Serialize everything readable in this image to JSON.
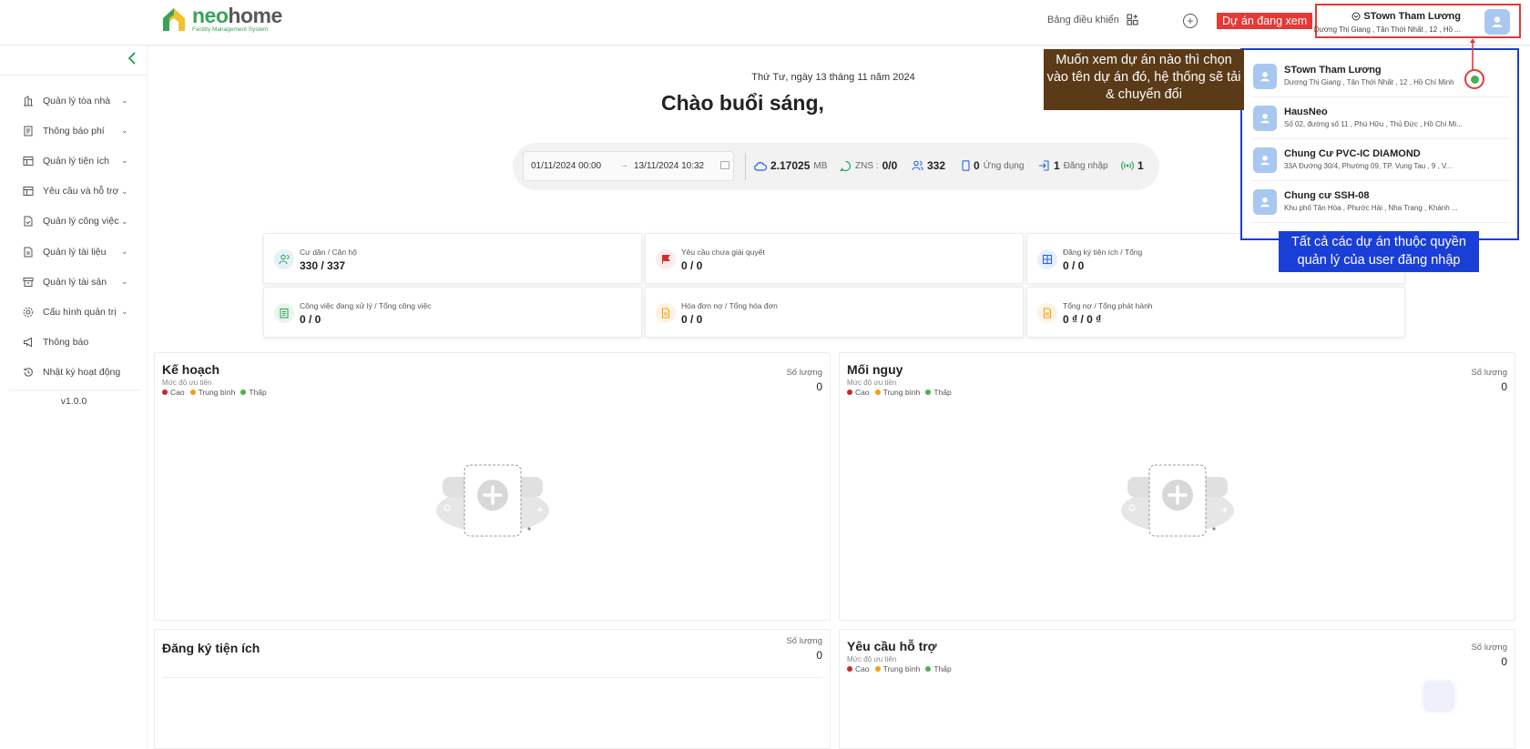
{
  "header": {
    "logo_word_a": "neo",
    "logo_word_b": "home",
    "logo_subtitle": "Facility Management System",
    "dashboard_label": "Bảng điều khiển",
    "viewing_tag": "Dự án đang xem",
    "current_project": {
      "name": "STown Tham Lương",
      "address": "Dương Thị Giang , Tân Thới Nhất , 12 , Hồ ..."
    }
  },
  "sidebar": {
    "items": [
      {
        "label": "Quản lý tòa nhà",
        "icon": "building-icon",
        "has_children": true
      },
      {
        "label": "Thông báo phí",
        "icon": "receipt-icon",
        "has_children": true
      },
      {
        "label": "Quản lý tiện ích",
        "icon": "table-icon",
        "has_children": true
      },
      {
        "label": "Yêu cầu và hỗ trợ",
        "icon": "table-icon",
        "has_children": true
      },
      {
        "label": "Quản lý công việc",
        "icon": "task-icon",
        "has_children": true
      },
      {
        "label": "Quản lý tài liệu",
        "icon": "document-icon",
        "has_children": true
      },
      {
        "label": "Quản lý tài sản",
        "icon": "archive-icon",
        "has_children": true
      },
      {
        "label": "Cấu hình quản trị",
        "icon": "gear-icon",
        "has_children": true
      },
      {
        "label": "Thông báo",
        "icon": "megaphone-icon",
        "has_children": false
      },
      {
        "label": "Nhật ký hoạt động",
        "icon": "history-icon",
        "has_children": false
      }
    ],
    "version": "v1.0.0"
  },
  "main": {
    "date": "Thứ Tư, ngày 13 tháng 11 năm 2024",
    "greeting": "Chào buổi sáng,",
    "range_from": "01/11/2024 00:00",
    "range_to": "13/11/2024 10:32",
    "range_arrow": "→",
    "stats": {
      "storage_value": "2.17025",
      "storage_unit": "MB",
      "zns_label": "ZNS :",
      "zns_value": "0/0",
      "users_value": "332",
      "app_value": "0",
      "app_label": "Ứng dụng",
      "login_value": "1",
      "login_label": "Đăng nhập",
      "online_value": "1"
    },
    "cards": [
      {
        "label": "Cư dân / Căn hộ",
        "value": "330 / 337",
        "icon": "users-icon",
        "color": "#e8f5ec"
      },
      {
        "label": "Yêu cầu chưa giải quyết",
        "value": "0 / 0",
        "icon": "flag-icon",
        "color": "#fdecec"
      },
      {
        "label": "Đăng ký tiện ích / Tổng",
        "value": "0 / 0",
        "icon": "grid-icon",
        "color": "#e9effd"
      },
      {
        "label": "Công việc đang xử lý / Tổng công việc",
        "value": "0 / 0",
        "icon": "clipboard-icon",
        "color": "#e8f5ec"
      },
      {
        "label": "Hóa đơn nợ / Tổng hóa đơn",
        "value": "0 / 0",
        "icon": "invoice-icon",
        "color": "#fdf3e4"
      },
      {
        "label": "Tổng nợ / Tổng phát hành",
        "value": "0 ₫ / 0 ₫",
        "icon": "invoice-icon",
        "color": "#fdf3e4"
      }
    ],
    "panels": {
      "plan": {
        "title": "Kế hoạch",
        "subtitle": "Mức độ ưu tiên",
        "count_label": "Số lượng",
        "count": "0"
      },
      "risk": {
        "title": "Mối nguy",
        "subtitle": "Mức độ ưu tiên",
        "count_label": "Số lượng",
        "count": "0"
      },
      "utility": {
        "title": "Đăng ký tiện ích",
        "count_label": "Số lượng",
        "count": "0"
      },
      "support": {
        "title": "Yêu cầu hỗ trợ",
        "subtitle": "Mức độ ưu tiên",
        "count_label": "Số lượng",
        "count": "0"
      }
    },
    "legend": {
      "high": "Cao",
      "medium": "Trung bình",
      "low": "Thấp"
    },
    "legend_colors": {
      "high": "#c62828",
      "medium": "#f59e0b",
      "low": "#4caf50"
    }
  },
  "dropdown": {
    "projects": [
      {
        "name": "STown Tham Lương",
        "address": "Dương Thị Giang , Tân Thới Nhất , 12 , Hồ Chí Minh"
      },
      {
        "name": "HausNeo",
        "address": "Số 02, đường số 11 , Phú Hữu , Thủ Đức , Hồ Chí Mi..."
      },
      {
        "name": "Chung Cư PVC-IC DIAMOND",
        "address": "33A Đường 30/4, Phường 09, TP. Vung Tau , 9 , V..."
      },
      {
        "name": "Chung cư SSH-08",
        "address": "Khu phố Tân Hòa , Phước Hải , Nha Trang , Khánh ..."
      }
    ]
  },
  "annotations": {
    "choose_hint": "Muốn xem dự án nào thì chọn vào tên dự án đó, hệ thống sẽ tải & chuyển đổi",
    "all_projects_hint": "Tất cả các dự án thuộc quyền quản lý của user đăng nhập"
  },
  "colors": {
    "brand_green": "#3aa35a",
    "annotation_red": "#e53935",
    "annotation_blue": "#1a3fd6",
    "annotation_brown": "#5a3a17"
  }
}
